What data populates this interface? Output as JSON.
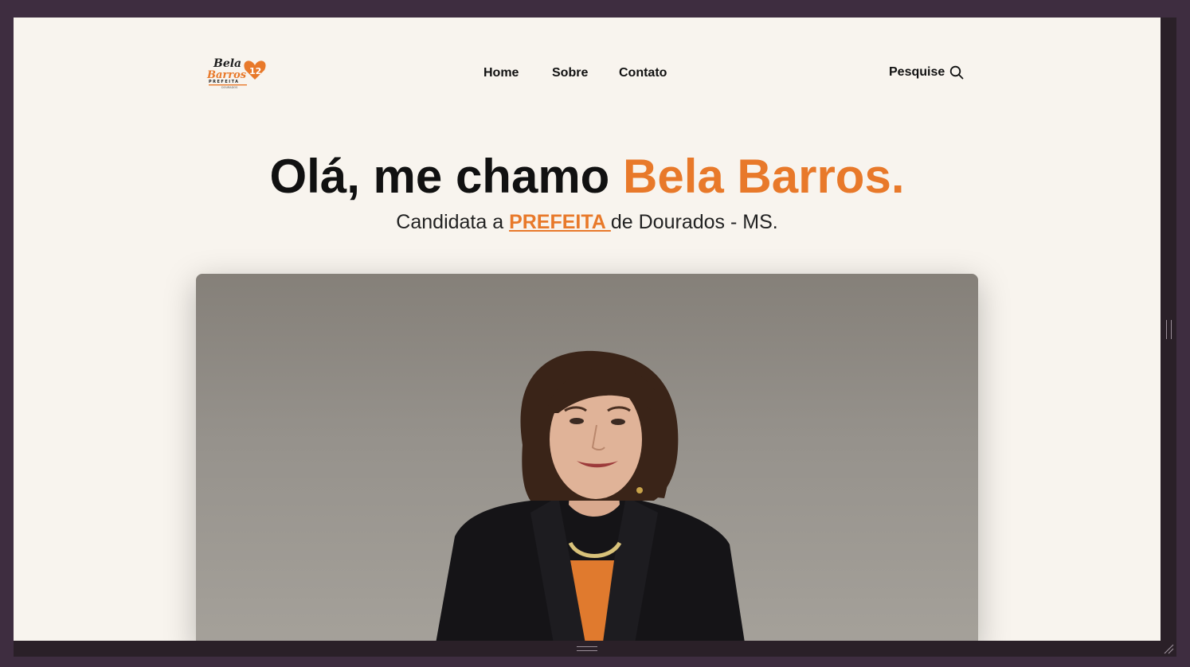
{
  "brand": {
    "logo_line1": "Bela",
    "logo_line2": "Barros",
    "logo_number": "12",
    "logo_role": "PREFEITA",
    "logo_city": "DOURADOS",
    "colors": {
      "accent": "#e8792a",
      "background": "#f8f4ee",
      "text": "#111111"
    }
  },
  "nav": {
    "items": [
      {
        "label": "Home"
      },
      {
        "label": "Sobre"
      },
      {
        "label": "Contato"
      }
    ],
    "search_label": "Pesquise",
    "search_icon": "search-icon"
  },
  "hero": {
    "title_prefix": "Olá, me chamo ",
    "title_name": "Bela Barros.",
    "subtitle_prefix": "Candidata a ",
    "subtitle_role": "PREFEITA ",
    "subtitle_suffix": "de Dourados - MS."
  },
  "photo": {
    "subject": "portrait-photo"
  }
}
